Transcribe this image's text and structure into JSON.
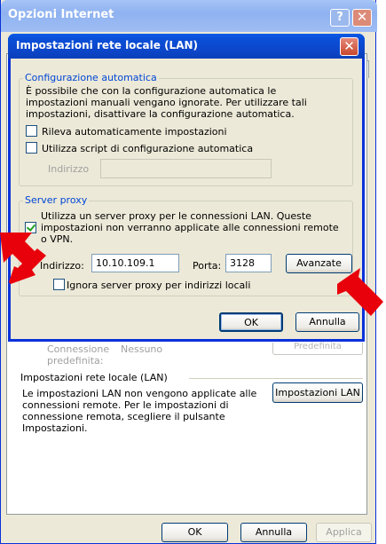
{
  "outer_window": {
    "title": "Opzioni Internet",
    "help_glyph": "?",
    "close_glyph": "✕",
    "faded_label_line1": "Connessione",
    "faded_label_line2": "predefinita:",
    "faded_value": "Nessuno",
    "faded_button": "Predefinita",
    "lan_section_title": "Impostazioni rete locale (LAN)",
    "lan_description": "Le impostazioni LAN non vengono applicate alle connessioni remote. Per le impostazioni di connessione remota, scegliere il pulsante Impostazioni.",
    "lan_button": "Impostazioni LAN",
    "ok_button": "OK",
    "cancel_button": "Annulla",
    "apply_button": "Applica"
  },
  "dialog": {
    "title": "Impostazioni rete locale (LAN)",
    "close_glyph": "✕",
    "auto_config": {
      "legend": "Configurazione automatica",
      "description": "È possibile che con la configurazione automatica le impostazioni manuali vengano ignorate. Per utilizzare tali impostazioni, disattivare la configurazione automatica.",
      "detect_label": "Rileva automaticamente impostazioni",
      "detect_checked": false,
      "script_label": "Utilizza script di configurazione automatica",
      "script_checked": false,
      "address_label": "Indirizzo",
      "address_value": ""
    },
    "proxy": {
      "legend": "Server proxy",
      "use_proxy_label": "Utilizza un server proxy per le connessioni LAN. Queste impostazioni non verranno applicate alle connessioni remote o VPN.",
      "use_proxy_checked": true,
      "address_label": "Indirizzo:",
      "address_value": "10.10.109.1",
      "port_label": "Porta:",
      "port_value": "3128",
      "advanced_button": "Avanzate",
      "bypass_label": "Ignora server proxy per indirizzi locali",
      "bypass_checked": false
    },
    "ok_button": "OK",
    "cancel_button": "Annulla"
  },
  "colors": {
    "title_bar_blue": "#0a4fd8",
    "group_legend_blue": "#0046d5",
    "annotation_arrow_red": "#e8000b"
  }
}
